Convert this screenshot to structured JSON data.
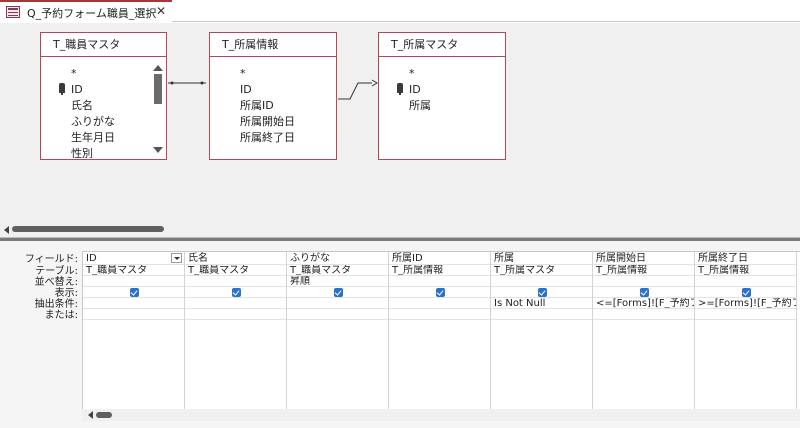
{
  "tab": {
    "title": "Q_予約フォーム職員_選択",
    "close_glyph": "✕",
    "icon": "query-icon"
  },
  "tables": [
    {
      "title": "T_職員マスタ",
      "fields": [
        "*",
        "ID",
        "氏名",
        "ふりがな",
        "生年月日",
        "性別"
      ],
      "key_field_index": 1,
      "has_scrollbar": true
    },
    {
      "title": "T_所属情報",
      "fields": [
        "*",
        "ID",
        "所属ID",
        "所属開始日",
        "所属終了日"
      ],
      "key_field_index": -1,
      "has_scrollbar": false
    },
    {
      "title": "T_所属マスタ",
      "fields": [
        "*",
        "ID",
        "所属"
      ],
      "key_field_index": 1,
      "has_scrollbar": false
    }
  ],
  "row_labels": [
    "フィールド:",
    "テーブル:",
    "並べ替え:",
    "表示:",
    "抽出条件:",
    "または:"
  ],
  "grid_columns": [
    {
      "field": "ID",
      "table": "T_職員マスタ",
      "sort": "",
      "show": true,
      "criteria": "",
      "has_dropdown": true
    },
    {
      "field": "氏名",
      "table": "T_職員マスタ",
      "sort": "",
      "show": true,
      "criteria": ""
    },
    {
      "field": "ふりがな",
      "table": "T_職員マスタ",
      "sort": "昇順",
      "show": true,
      "criteria": ""
    },
    {
      "field": "所属ID",
      "table": "T_所属情報",
      "sort": "",
      "show": true,
      "criteria": ""
    },
    {
      "field": "所属",
      "table": "T_所属マスタ",
      "sort": "",
      "show": true,
      "criteria": "Is Not Null"
    },
    {
      "field": "所属開始日",
      "table": "T_所属情報",
      "sort": "",
      "show": true,
      "criteria": "<=[Forms]![F_予約フォ"
    },
    {
      "field": "所属終了日",
      "table": "T_所属情報",
      "sort": "",
      "show": true,
      "criteria": ">=[Forms]![F_予約フォ"
    },
    {
      "field": "",
      "table": "",
      "sort": "",
      "show": false,
      "criteria": ""
    }
  ],
  "colors": {
    "table_border": "#b0485a",
    "checkbox": "#2b73c9",
    "tab_accent": "#a4373a"
  }
}
